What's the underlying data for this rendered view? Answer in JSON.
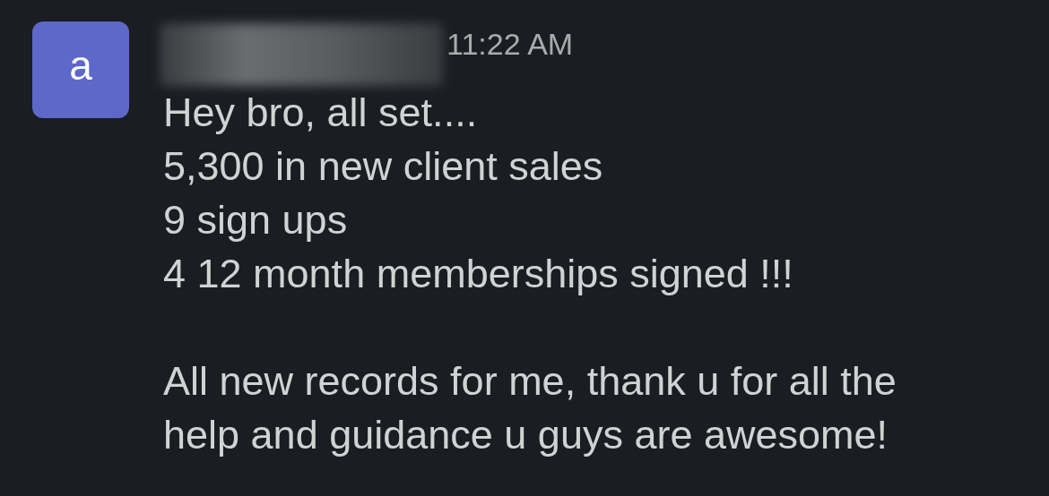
{
  "message": {
    "avatar": "a",
    "author_redacted": true,
    "time": "11:22 AM",
    "paragraphs": [
      [
        "Hey bro, all set....",
        "5,300 in new client sales",
        "9 sign ups",
        "4 12 month memberships signed !!!"
      ],
      [
        "All new records for me, thank u for all the",
        "help and guidance u guys are awesome!"
      ]
    ]
  }
}
